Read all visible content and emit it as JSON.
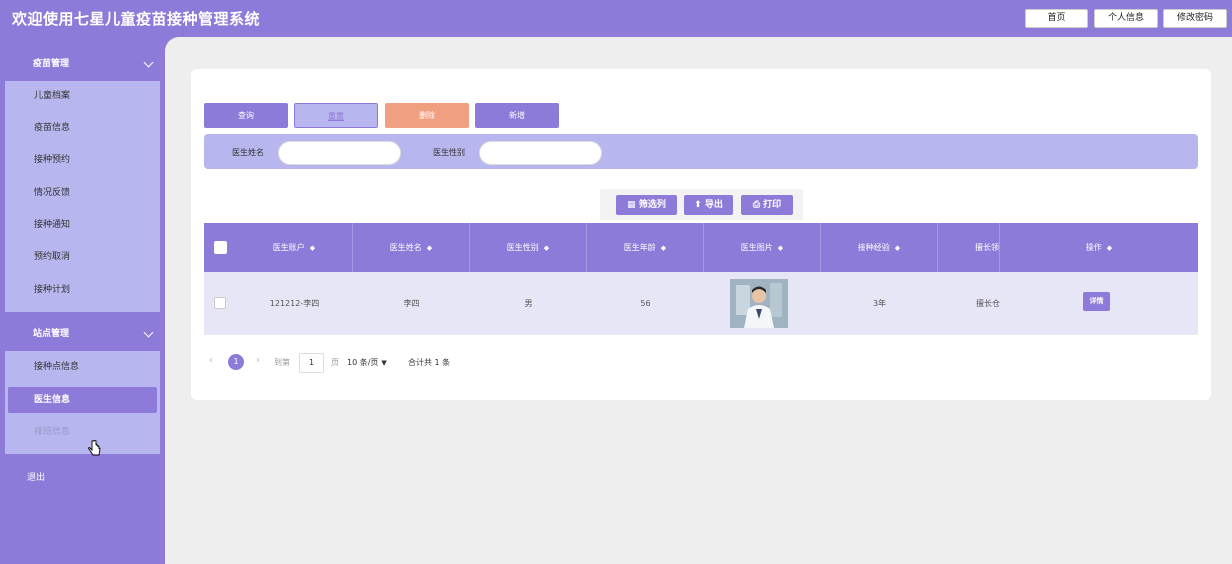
{
  "header": {
    "title": "欢迎使用七星儿童疫苗接种管理系统",
    "buttons": {
      "home": "首页",
      "profile": "个人信息",
      "password": "修改密码"
    }
  },
  "sidebar": {
    "groups": [
      {
        "label": "疫苗管理",
        "items": [
          "儿童档案",
          "疫苗信息",
          "接种预约",
          "情况反馈",
          "接种通知",
          "预约取消",
          "接种计划"
        ]
      },
      {
        "label": "站点管理",
        "items": [
          "接种点信息",
          "医生信息",
          "排班信息"
        ]
      }
    ],
    "active_item": "医生信息",
    "logout": "退出"
  },
  "actions": {
    "query": "查询",
    "reset": "重置",
    "delete": "删除",
    "add": "新增"
  },
  "filters": {
    "name_label": "医生姓名",
    "gender_label": "医生性别"
  },
  "toolbar": {
    "columns": "筛选列",
    "export": "导出",
    "print": "打印"
  },
  "table": {
    "headers": [
      "医生账户",
      "医生姓名",
      "医生性别",
      "医生年龄",
      "医生图片",
      "接种经验",
      "擅长领",
      "操作"
    ],
    "rows": [
      {
        "account": "121212-李四",
        "name": "李四",
        "gender": "男",
        "age": "56",
        "experience": "3年",
        "specialty": "擅长仓",
        "detail": "详情"
      }
    ]
  },
  "pagination": {
    "current": "1",
    "goto_label": "到第",
    "page_input": "1",
    "page_unit": "页",
    "page_size": "10 条/页",
    "total": "合计共 1 条"
  },
  "colors": {
    "accent": "#8e7ad8",
    "panel": "#b8b6ee",
    "delete": "#f0a080",
    "reset": "#b8b6ee"
  }
}
